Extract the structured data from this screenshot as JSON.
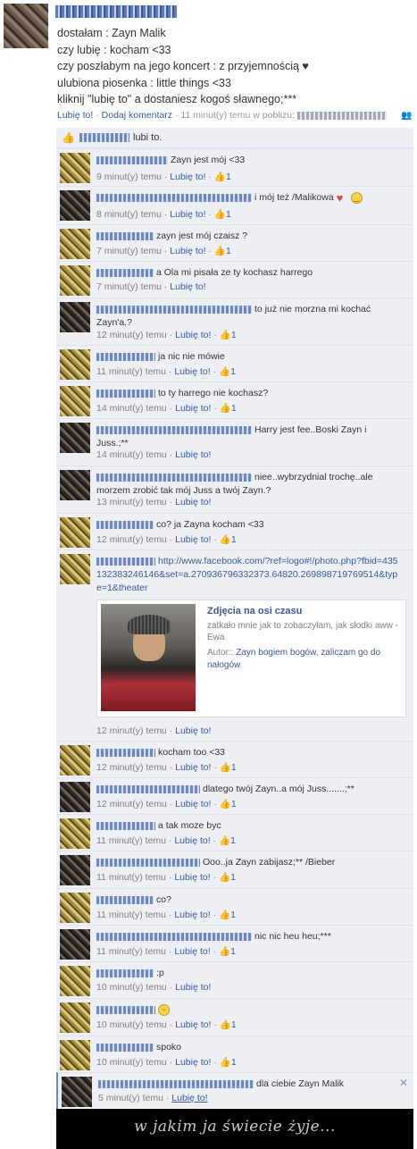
{
  "post": {
    "lines": [
      "dostałam : Zayn Malik",
      "czy lubię : kocham <33",
      "czy poszłabym na jego koncert : z przyjemnością ♥",
      "ulubiona piosenka : little things <33",
      "kliknij \"lubię to\" a dostaniesz kogoś sławnego;***"
    ],
    "like_label": "Lubię to!",
    "comment_label": "Dodaj komentarz",
    "time_label": "11 minut(y) temu w pobliżu:",
    "sep": "·"
  },
  "likes": {
    "text": "lubi to."
  },
  "comment_meta": {
    "like_label": "Lubię to!",
    "like_count": "1"
  },
  "comments": [
    {
      "text": "Zayn jest mój <33",
      "time": "9 minut(y) temu",
      "count": "1"
    },
    {
      "text": "i mój też /Malikowa",
      "time": "8 minut(y) temu",
      "count": "1"
    },
    {
      "text": "zayn jest mój czaisz ?",
      "time": "7 minut(y) temu",
      "count": "1"
    },
    {
      "text": "a Ola mi pisała ze ty kochasz harrego",
      "time": "7 minut(y) temu"
    },
    {
      "text": "to już nie morzna mi kochać Zayn'a.?",
      "time": "12 minut(y) temu",
      "count": "1"
    },
    {
      "text": "ja nic nie mówie",
      "time": "11 minut(y) temu",
      "count": "1"
    },
    {
      "text": "to ty harrego nie kochasz?",
      "time": "14 minut(y) temu",
      "count": "1"
    },
    {
      "text": "Harry jest fee..Boski Zayn i Juss.;**",
      "time": "14 minut(y) temu"
    },
    {
      "text": "niee..wybrzydnial trochę..ale morzem zrobić tak mój Juss a twój Zayn.?",
      "time": "13 minut(y) temu"
    },
    {
      "text": "co? ja Zayna kocham <33",
      "time": "12 minut(y) temu",
      "count": "1"
    },
    {
      "text": "http://www.facebook.com/?ref=logo#!/photo.php?fbid=435132383246146&set=a.270936796332373.64820.269898719769514&type=1&theater",
      "time": "12 minut(y) temu"
    },
    {
      "text": "kocham too <33",
      "time": "12 minut(y) temu",
      "count": "1"
    },
    {
      "text": "dlatego twój Zayn..a mój Juss.......;**",
      "time": "12 minut(y) temu",
      "count": "1"
    },
    {
      "text": "a tak moze byc",
      "time": "11 minut(y) temu",
      "count": "1"
    },
    {
      "text": "Ooo..ja Zayn zabijasz;** /Bieber",
      "time": "11 minut(y) temu",
      "count": "1"
    },
    {
      "text": "co?",
      "time": "11 minut(y) temu",
      "count": "1"
    },
    {
      "text": "nic nic heu heu;***",
      "time": "11 minut(y) temu",
      "count": "1"
    },
    {
      "text": ":p",
      "time": "10 minut(y) temu"
    },
    {
      "text": "",
      "time": "10 minut(y) temu",
      "count": "1"
    },
    {
      "text": "spoko",
      "time": "10 minut(y) temu",
      "count": "1"
    },
    {
      "text": "dla ciebie Zayn Malik",
      "time": "5 minut(y) temu"
    }
  ],
  "share": {
    "title": "Zdjęcia na osi czasu",
    "description": "zatkało mnie jak to zobaczyłam, jak słodki aww - Ewa",
    "author_label": "Autor::",
    "author_value": "Zayn bogiem bogów, zaliczam go do nałogów"
  },
  "banner": {
    "text": "w jakim ja świecie żyje..."
  }
}
